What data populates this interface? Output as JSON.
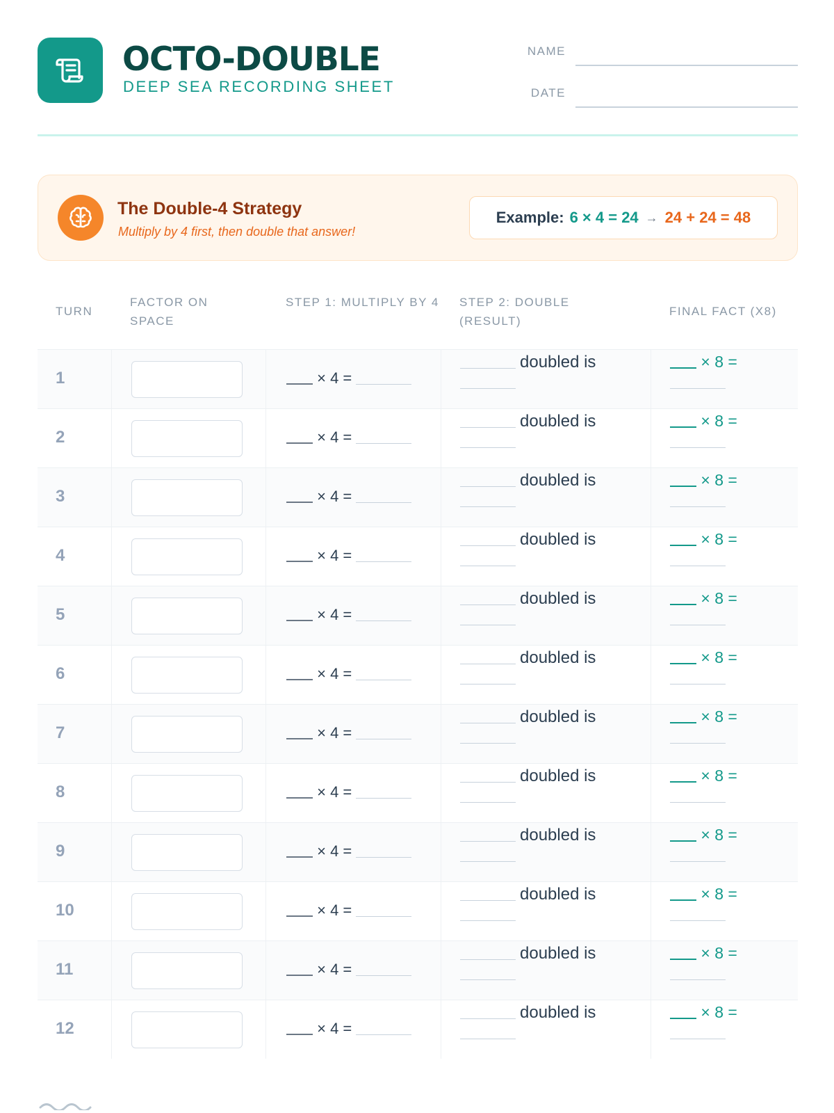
{
  "header": {
    "title": "OCTO-DOUBLE",
    "subtitle": "DEEP SEA RECORDING SHEET",
    "logo_icon": "scroll-icon",
    "name_label": "NAME",
    "date_label": "DATE"
  },
  "strategy": {
    "icon": "brain-icon",
    "title": "The Double-4 Strategy",
    "subtitle": "Multiply by 4 first, then double that answer!",
    "example_label": "Example:",
    "example_step1": "6 × 4 = 24",
    "example_arrow": "→",
    "example_step2": "24 + 24 = 48"
  },
  "table": {
    "headers": {
      "turn": "TURN",
      "factor": "FACTOR ON SPACE",
      "step1": "STEP 1: MULTIPLY BY 4",
      "step2": "STEP 2: DOUBLE (RESULT)",
      "final": "FINAL FACT (X8)"
    },
    "step1_text": "× 4 =",
    "step2_text": "doubled is",
    "final_text": "× 8 =",
    "rows": [
      "1",
      "2",
      "3",
      "4",
      "5",
      "6",
      "7",
      "8",
      "9",
      "10",
      "11",
      "12"
    ]
  },
  "colors": {
    "teal": "#13998a",
    "dark_teal": "#0c4a45",
    "orange": "#e8671c",
    "muted": "#8a98a6"
  }
}
